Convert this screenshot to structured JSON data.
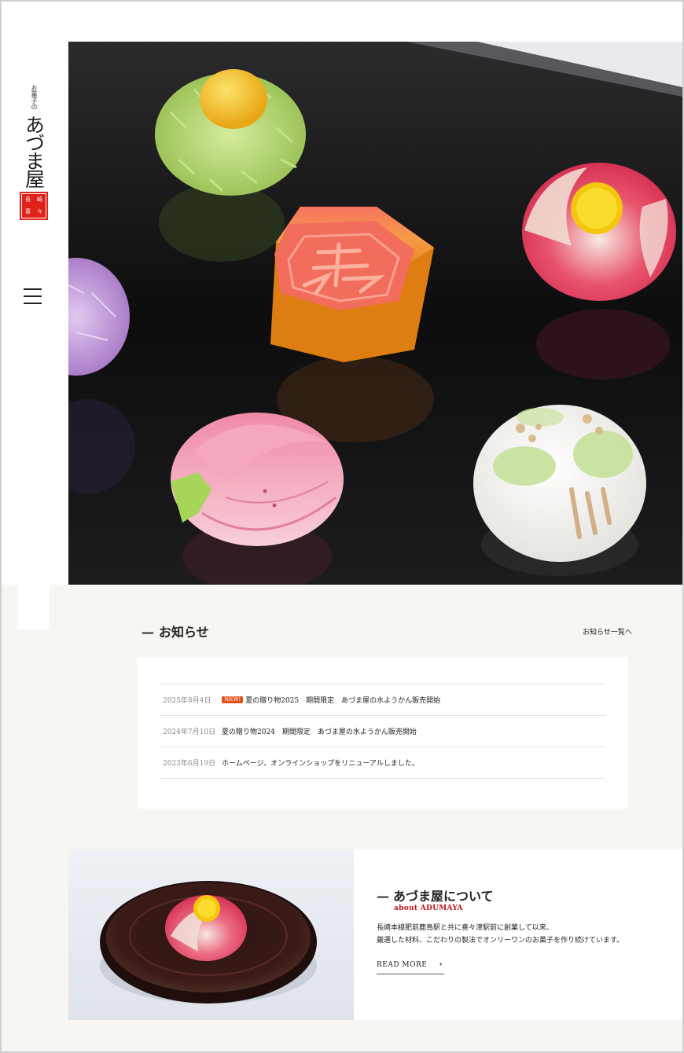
{
  "logo": {
    "subtitle": "お菓子の",
    "name": "あづま屋",
    "seal_chars": [
      "長",
      "崎",
      "喜",
      "々"
    ]
  },
  "menu": {
    "icon": "hamburger-menu-icon"
  },
  "hero": {
    "image": "wagashi-assortment-on-black-lacquer"
  },
  "news": {
    "heading": "お知らせ",
    "more_link": "お知らせ一覧へ",
    "items": [
      {
        "date": "2025年8月4日",
        "badge": "NEW!",
        "title": "夏の贈り物2025　期間限定　あづま屋の水ようかん販売開始"
      },
      {
        "date": "2024年7月10日",
        "badge": "",
        "title": "夏の贈り物2024　期間限定　あづま屋の水ようかん販売開始"
      },
      {
        "date": "2023年6月19日",
        "badge": "",
        "title": "ホームページ、オンラインショップをリニューアルしました。"
      }
    ]
  },
  "about": {
    "heading": "あづま屋について",
    "subheading": "about ADUMAYA",
    "text_line1": "長崎本線肥前鹿島駅と共に喜々津駅前に創業して以来、",
    "text_line2": "厳選した材料、こだわりの製法でオンリーワンのお菓子を作り続けています。",
    "read_more": "READ MORE",
    "image": "camellia-wagashi-on-lacquer-plate"
  },
  "colors": {
    "background": "#f7f6f2",
    "accent_red": "#c0121a",
    "new_badge": "#e0541c",
    "seal_red": "#e0221b"
  }
}
